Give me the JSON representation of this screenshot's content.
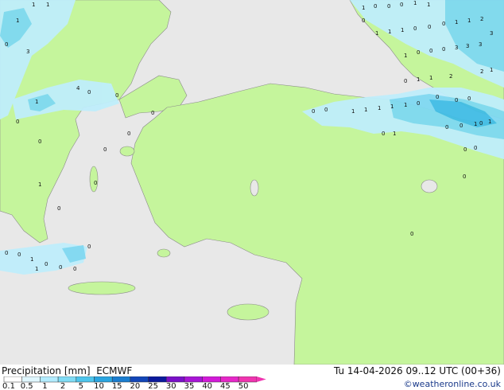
{
  "footer": {
    "product_label": "Precipitation [mm]",
    "model_label": "ECMWF",
    "valid_time": "Tu 14-04-2026 09..12 UTC (00+36)",
    "credit": "©weatheronline.co.uk"
  },
  "legend": {
    "ticks": [
      "0.1",
      "0.5",
      "1",
      "2",
      "5",
      "10",
      "15",
      "20",
      "25",
      "30",
      "35",
      "40",
      "45",
      "50"
    ],
    "colors": [
      "#ffffff",
      "#e0f7ff",
      "#b3ecff",
      "#80dcf5",
      "#4ec5ec",
      "#2aa5e0",
      "#1a7dd0",
      "#1246b8",
      "#0b1a9c",
      "#7a10c8",
      "#a815d6",
      "#d21ad8",
      "#e627c8",
      "#f034b0"
    ]
  },
  "colors": {
    "sea": "#e8e8e8",
    "land": "#c5f59c",
    "precip_light": "#bfeefb",
    "precip_medium": "#7fd9f2",
    "precip_heavy": "#41bde6",
    "coast": "#8a8a8a"
  },
  "point_values": [
    {
      "label": "1"
    },
    {
      "label": "1"
    },
    {
      "label": "1"
    },
    {
      "label": "0"
    },
    {
      "label": "3"
    },
    {
      "label": "1"
    },
    {
      "label": "0"
    },
    {
      "label": "0"
    },
    {
      "label": "0"
    },
    {
      "label": "1"
    },
    {
      "label": "1"
    },
    {
      "label": "0"
    },
    {
      "label": "1"
    },
    {
      "label": "1"
    },
    {
      "label": "1"
    },
    {
      "label": "0"
    },
    {
      "label": "0"
    },
    {
      "label": "0"
    },
    {
      "label": "1"
    },
    {
      "label": "1"
    },
    {
      "label": "2"
    },
    {
      "label": "3"
    },
    {
      "label": "3"
    },
    {
      "label": "1"
    },
    {
      "label": "0"
    },
    {
      "label": "0"
    },
    {
      "label": "0"
    },
    {
      "label": "3"
    },
    {
      "label": "3"
    },
    {
      "label": "2"
    },
    {
      "label": "1"
    },
    {
      "label": "0"
    },
    {
      "label": "1"
    },
    {
      "label": "1"
    },
    {
      "label": "2"
    },
    {
      "label": "1"
    },
    {
      "label": "1"
    },
    {
      "label": "1"
    },
    {
      "label": "1"
    },
    {
      "label": "1"
    },
    {
      "label": "0"
    },
    {
      "label": "0"
    },
    {
      "label": "0"
    },
    {
      "label": "0"
    },
    {
      "label": "1"
    },
    {
      "label": "0"
    },
    {
      "label": "1"
    },
    {
      "label": "0"
    },
    {
      "label": "0"
    },
    {
      "label": "1"
    },
    {
      "label": "0"
    },
    {
      "label": "0"
    },
    {
      "label": "4"
    },
    {
      "label": "0"
    },
    {
      "label": "0"
    },
    {
      "label": "1"
    },
    {
      "label": "0"
    },
    {
      "label": "0"
    },
    {
      "label": "1"
    },
    {
      "label": "0"
    },
    {
      "label": "0"
    },
    {
      "label": "0"
    },
    {
      "label": "0"
    },
    {
      "label": "0"
    },
    {
      "label": "1"
    },
    {
      "label": "0"
    },
    {
      "label": "0"
    },
    {
      "label": "0"
    },
    {
      "label": "1"
    },
    {
      "label": "0"
    },
    {
      "label": "0"
    },
    {
      "label": "0"
    },
    {
      "label": "0"
    },
    {
      "label": "0"
    },
    {
      "label": "0"
    },
    {
      "label": "0"
    },
    {
      "label": "0"
    }
  ]
}
